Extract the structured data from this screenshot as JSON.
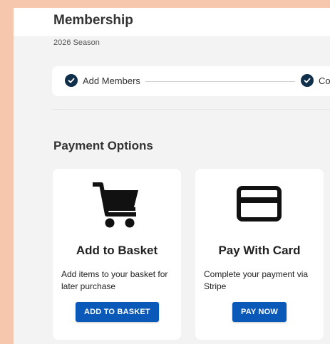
{
  "header": {
    "title": "Membership",
    "subtitle": "2026 Season"
  },
  "stepper": {
    "steps": [
      {
        "label": "Add Members",
        "status": "complete"
      },
      {
        "label": "Co",
        "status": "complete"
      }
    ]
  },
  "payment": {
    "section_title": "Payment Options",
    "options": [
      {
        "icon": "shopping-cart-icon",
        "title": "Add to Basket",
        "description": "Add items to your basket for later purchase",
        "button_label": "ADD TO BASKET"
      },
      {
        "icon": "credit-card-icon",
        "title": "Pay With Card",
        "description": "Complete your payment via Stripe",
        "button_label": "PAY NOW"
      }
    ]
  },
  "colors": {
    "primary_button": "#0a58b7",
    "step_check": "#0f2f4b",
    "background_outer": "#f6c6ad",
    "background_panel": "#f3f3f3"
  }
}
